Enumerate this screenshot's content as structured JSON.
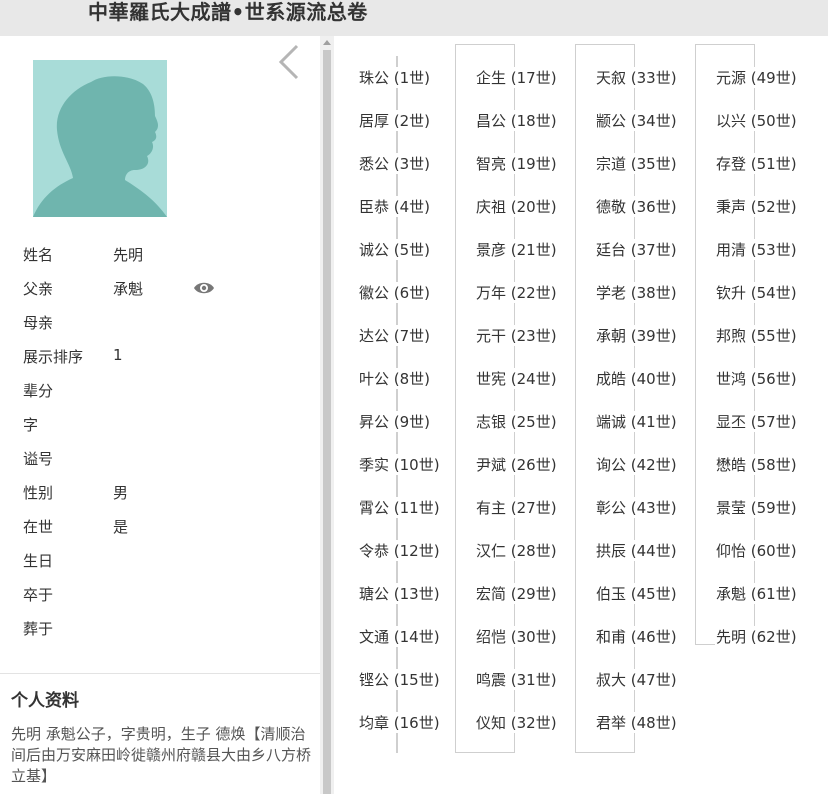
{
  "header": {
    "title": "中華羅氏大成譜•世系源流总卷"
  },
  "person": {
    "fields": [
      {
        "label": "姓名",
        "value": "先明"
      },
      {
        "label": "父亲",
        "value": "承魁"
      },
      {
        "label": "母亲",
        "value": ""
      },
      {
        "label": "展示排序",
        "value": "1"
      },
      {
        "label": "辈分",
        "value": ""
      },
      {
        "label": "字",
        "value": ""
      },
      {
        "label": "谥号",
        "value": ""
      },
      {
        "label": "性别",
        "value": "男"
      },
      {
        "label": "在世",
        "value": "是"
      },
      {
        "label": "生日",
        "value": ""
      },
      {
        "label": "卒于",
        "value": ""
      },
      {
        "label": "葬于",
        "value": ""
      }
    ],
    "profile_title": "个人资料",
    "bio": "先明  承魁公子，字贵明，生子 德焕【清顺治间后由万安麻田岭徙赣州府赣县大由乡八方桥立基】"
  },
  "icons": {
    "back": "chevron-left-icon",
    "view": "eye-icon",
    "avatar": "person-silhouette-icon"
  },
  "colors": {
    "avatar_bg": "#a8dcd8",
    "avatar_fg": "#6fb5ae"
  },
  "generations": [
    "珠公 (1世)",
    "居厚 (2世)",
    "悉公 (3世)",
    "臣恭 (4世)",
    "诚公 (5世)",
    "徽公 (6世)",
    "达公 (7世)",
    "叶公 (8世)",
    "昇公 (9世)",
    "季实 (10世)",
    "霄公 (11世)",
    "令恭 (12世)",
    "瑭公 (13世)",
    "文通 (14世)",
    "铿公 (15世)",
    "均章 (16世)",
    "企生 (17世)",
    "昌公 (18世)",
    "智亮 (19世)",
    "庆祖 (20世)",
    "景彦 (21世)",
    "万年 (22世)",
    "元干 (23世)",
    "世宪 (24世)",
    "志银 (25世)",
    "尹斌 (26世)",
    "有主 (27世)",
    "汉仁 (28世)",
    "宏简 (29世)",
    "绍恺 (30世)",
    "鸣震 (31世)",
    "仪知 (32世)",
    "天叙 (33世)",
    "颛公 (34世)",
    "宗道 (35世)",
    "德敬 (36世)",
    "廷台 (37世)",
    "学老 (38世)",
    "承朝 (39世)",
    "成皓 (40世)",
    "端诚 (41世)",
    "询公 (42世)",
    "彰公 (43世)",
    "拱辰 (44世)",
    "伯玉 (45世)",
    "和甫 (46世)",
    "叔大 (47世)",
    "君举 (48世)",
    "元源 (49世)",
    "以兴 (50世)",
    "存登 (51世)",
    "秉声 (52世)",
    "用清 (53世)",
    "钦升 (54世)",
    "邦煦 (55世)",
    "世鸿 (56世)",
    "显丕 (57世)",
    "懋皓 (58世)",
    "景莹 (59世)",
    "仰怡 (60世)",
    "承魁 (61世)",
    "先明 (62世)"
  ]
}
